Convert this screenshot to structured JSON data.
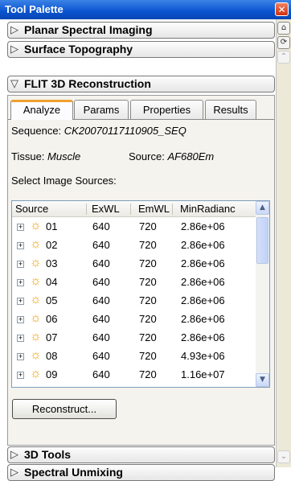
{
  "window": {
    "title": "Tool Palette",
    "close_glyph": "✕"
  },
  "sections": [
    {
      "label": "Planar Spectral Imaging",
      "expanded": false
    },
    {
      "label": "Surface Topography",
      "expanded": false
    },
    {
      "label": "FLIT 3D Reconstruction",
      "expanded": true
    },
    {
      "label": "3D Tools",
      "expanded": false
    },
    {
      "label": "Spectral Unmixing",
      "expanded": false
    }
  ],
  "tabs": [
    "Analyze",
    "Params",
    "Properties",
    "Results"
  ],
  "active_tab": "Analyze",
  "info": {
    "sequence_label": "Sequence:",
    "sequence_value": "CK20070117110905_SEQ",
    "tissue_label": "Tissue:",
    "tissue_value": "Muscle",
    "source_label": "Source:",
    "source_value": "AF680Em",
    "select_label": "Select Image Sources:"
  },
  "table": {
    "columns": [
      "Source",
      "ExWL",
      "EmWL",
      "MinRadianc"
    ],
    "rows": [
      {
        "source": "01",
        "exwl": "640",
        "emwl": "720",
        "min": "2.86e+06"
      },
      {
        "source": "02",
        "exwl": "640",
        "emwl": "720",
        "min": "2.86e+06"
      },
      {
        "source": "03",
        "exwl": "640",
        "emwl": "720",
        "min": "2.86e+06"
      },
      {
        "source": "04",
        "exwl": "640",
        "emwl": "720",
        "min": "2.86e+06"
      },
      {
        "source": "05",
        "exwl": "640",
        "emwl": "720",
        "min": "2.86e+06"
      },
      {
        "source": "06",
        "exwl": "640",
        "emwl": "720",
        "min": "2.86e+06"
      },
      {
        "source": "07",
        "exwl": "640",
        "emwl": "720",
        "min": "2.86e+06"
      },
      {
        "source": "08",
        "exwl": "640",
        "emwl": "720",
        "min": "4.93e+06"
      },
      {
        "source": "09",
        "exwl": "640",
        "emwl": "720",
        "min": "1.16e+07"
      }
    ]
  },
  "reconstruct_label": "Reconstruct...",
  "icons": {
    "row_expand": "plus-box-icon",
    "row_source": "sun-icon"
  },
  "colors": {
    "titlebar": "#0a53d0",
    "active_tab_accent": "#f0a030",
    "sun": "#f0a000"
  }
}
